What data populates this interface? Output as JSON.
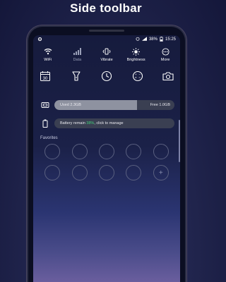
{
  "headline": "Side toolbar",
  "status": {
    "battery": "38%",
    "time": "15:25"
  },
  "toggles": [
    {
      "label": "WiFi",
      "icon": "wifi-icon",
      "active": true
    },
    {
      "label": "Data",
      "icon": "signal-icon",
      "active": false
    },
    {
      "label": "Vibrate",
      "icon": "vibrate-icon",
      "active": true
    },
    {
      "label": "Brightness",
      "icon": "brightness-icon",
      "active": true
    },
    {
      "label": "More",
      "icon": "more-icon",
      "active": true
    }
  ],
  "tools": [
    "calendar-icon",
    "flashlight-icon",
    "clock-icon",
    "calculator-icon",
    "camera-icon"
  ],
  "calendar_day": "30",
  "memory": {
    "used": "Used 2.3GB",
    "free": "Free 1.0GB",
    "used_fraction": 0.69
  },
  "battery": {
    "prefix": "Battery remain ",
    "percent": "38%",
    "suffix": ", click to manage"
  },
  "favorites": {
    "label": "Favorites",
    "slots": 10,
    "add_glyph": "+"
  },
  "colors": {
    "accent_green": "#43d17a",
    "bar_bg": "#3a3f52",
    "bar_fill": "#8e92a0"
  }
}
